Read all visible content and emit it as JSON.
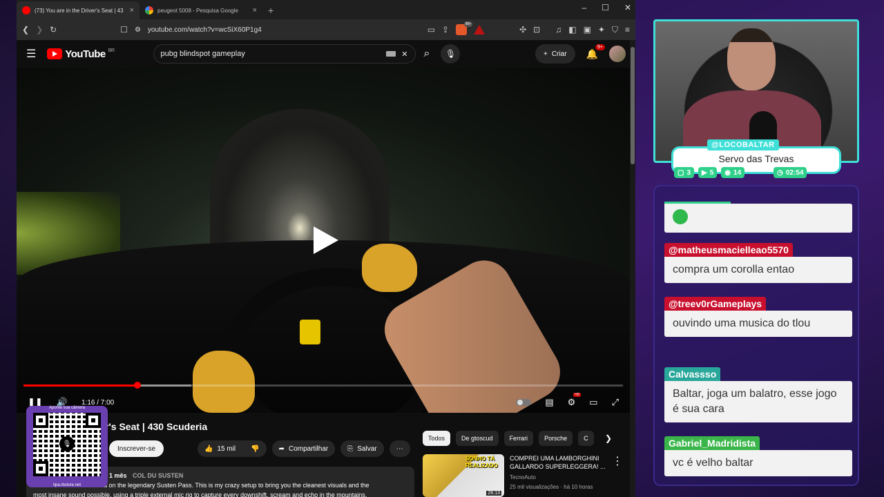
{
  "browser": {
    "tabs": [
      {
        "title": "(73) You are in the Driver's Seat | 43",
        "active": true
      },
      {
        "title": "peugeot 5008 - Pesquisa Google",
        "active": false
      }
    ],
    "url": "youtube.com/watch?v=wcSiX60P1g4",
    "brave_badge": "99+",
    "window_controls": [
      "–",
      "☐",
      "✕"
    ]
  },
  "youtube": {
    "logo": "YouTube",
    "logo_region": "BR",
    "search_value": "pubg blindspot gameplay",
    "create_label": "Criar",
    "notifications": "9+"
  },
  "player": {
    "progress_fraction": 0.19,
    "buffer_fraction": 0.28,
    "time": "1:16 / 7:00"
  },
  "video": {
    "title": "r's Seat | 430 Scuderia",
    "subscribe": "Inscrever-se",
    "likes": "15 mil",
    "share": "Compartilhar",
    "save": "Salvar",
    "age": "1 mês",
    "hashtag": "COL DU SUSTEN",
    "desc_line1": "ia on the legendary Susten Pass. This is my crazy setup to bring you the cleanest visuals and the",
    "desc_line2": "most insane sound possible, using a triple external mic rig to capture every downshift, scream and echo in the mountains."
  },
  "chips": [
    "Todos",
    "De gtoscud",
    "Ferrari",
    "Porsche",
    "C"
  ],
  "recommendation": {
    "thumb_text": "SONHO TÁ REALIZADO",
    "duration": "26:13",
    "title": "COMPREI UMA LAMBORGHINI GALLARDO SUPERLEGGERA! ...",
    "channel": "TecnoAuto",
    "meta": "25 mil visualizações · há 10 horas"
  },
  "qr": {
    "top_label": "Aponte sua câmera",
    "url": "tipa.rbstore.net"
  },
  "stream": {
    "handle": "@LOCOBALTAR",
    "title": "Servo das Trevas",
    "stats": [
      "3",
      "5",
      "14"
    ],
    "uptime": "02:54",
    "accent": "#3ee0d8"
  },
  "chat": [
    {
      "user": "",
      "text": "",
      "emote": true,
      "color": "#2fd08a"
    },
    {
      "user": "@matheusmacielleao5570",
      "text": "compra um corolla entao",
      "color": "#c8102e"
    },
    {
      "user": "@treev0rGameplays",
      "text": "ouvindo uma musica do tlou",
      "color": "#c8102e"
    },
    {
      "user": "Calvassso",
      "text": "Baltar, joga um balatro, esse jogo é sua cara",
      "color": "#2aa79b"
    },
    {
      "user": "Gabriel_Madridista",
      "text": "vc é velho baltar",
      "color": "#3ab54a"
    }
  ]
}
